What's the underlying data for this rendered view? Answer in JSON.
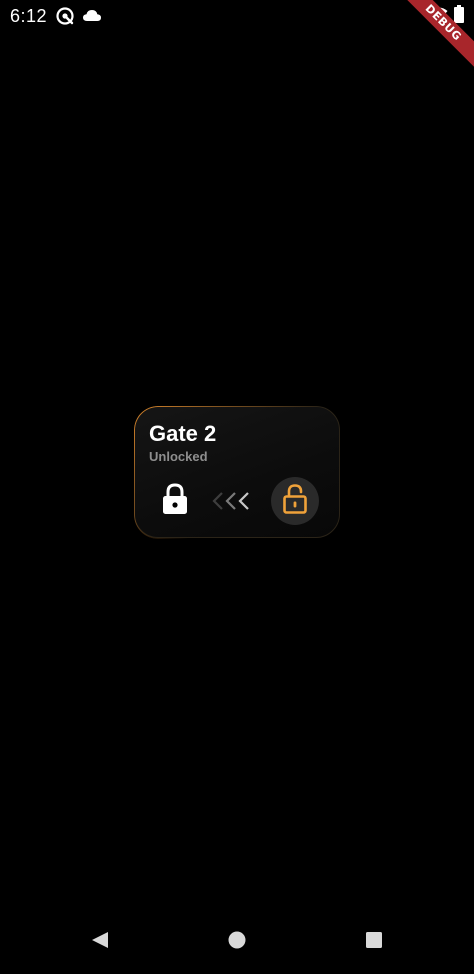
{
  "status_bar": {
    "time": "6:12",
    "icons": [
      "vpn-icon",
      "cloud-icon",
      "wifi-icon",
      "battery-icon"
    ]
  },
  "debug_banner": {
    "label": "DEBUG"
  },
  "gate_card": {
    "title": "Gate 2",
    "status": "Unlocked",
    "accent_color": "#f0a23a",
    "lock_icon": "lock-closed-icon",
    "swipe_icon": "triple-chevron-left-icon",
    "unlock_icon": "lock-open-icon"
  },
  "nav_bar": {
    "buttons": [
      "back-icon",
      "home-icon",
      "recents-icon"
    ]
  }
}
